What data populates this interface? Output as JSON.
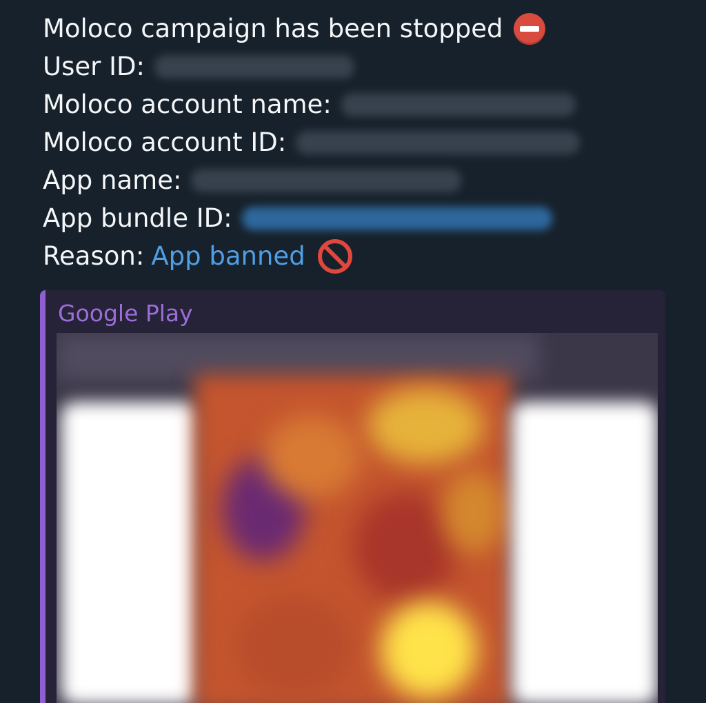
{
  "message": {
    "title": "Moloco campaign has been stopped",
    "title_emoji": "no-entry-icon",
    "fields": [
      {
        "label": "User ID:"
      },
      {
        "label": "Moloco account name:"
      },
      {
        "label": "Moloco account ID:"
      },
      {
        "label": "App name:"
      },
      {
        "label": "App bundle ID:"
      },
      {
        "label": "Reason:",
        "value": "App banned"
      }
    ],
    "reason_emoji": "prohibited-icon"
  },
  "preview": {
    "site_name": "Google Play"
  },
  "colors": {
    "background": "#17212b",
    "link": "#4f9fe6",
    "preview_accent": "#8f5fd2"
  }
}
